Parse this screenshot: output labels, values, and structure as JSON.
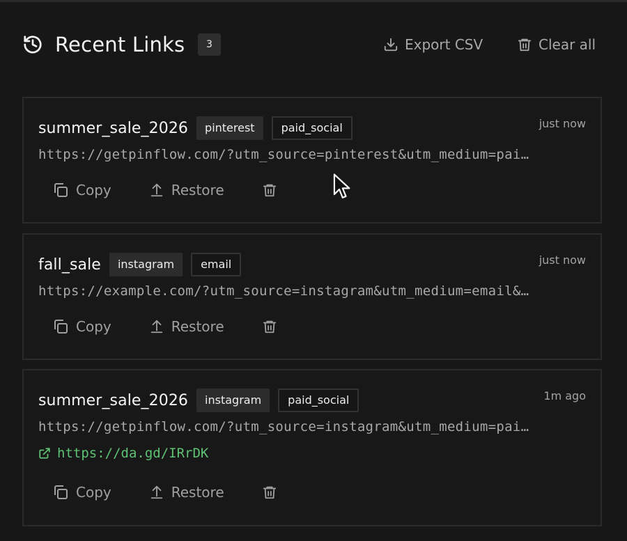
{
  "header": {
    "title": "Recent Links",
    "count": "3",
    "export_label": "Export CSV",
    "clear_label": "Clear all"
  },
  "links": [
    {
      "campaign": "summer_sale_2026",
      "source": "pinterest",
      "medium": "paid_social",
      "time": "just now",
      "url": "https://getpinflow.com/?utm_source=pinterest&utm_medium=pai…",
      "short_url": ""
    },
    {
      "campaign": "fall_sale",
      "source": "instagram",
      "medium": "email",
      "time": "just now",
      "url": "https://example.com/?utm_source=instagram&utm_medium=email&…",
      "short_url": ""
    },
    {
      "campaign": "summer_sale_2026",
      "source": "instagram",
      "medium": "paid_social",
      "time": "1m ago",
      "url": "https://getpinflow.com/?utm_source=instagram&utm_medium=pai…",
      "short_url": "https://da.gd/IRrDK"
    }
  ],
  "actions": {
    "copy_label": "Copy",
    "restore_label": "Restore"
  },
  "icons": {
    "header": "history-icon",
    "export": "download-icon",
    "clear": "trash-icon",
    "copy": "copy-icon",
    "restore": "upload-icon",
    "delete": "trash-icon",
    "short_link": "external-link-icon"
  },
  "colors": {
    "background": "#171717",
    "short_link": "#5ec274",
    "muted_text": "#a8a8a8"
  }
}
